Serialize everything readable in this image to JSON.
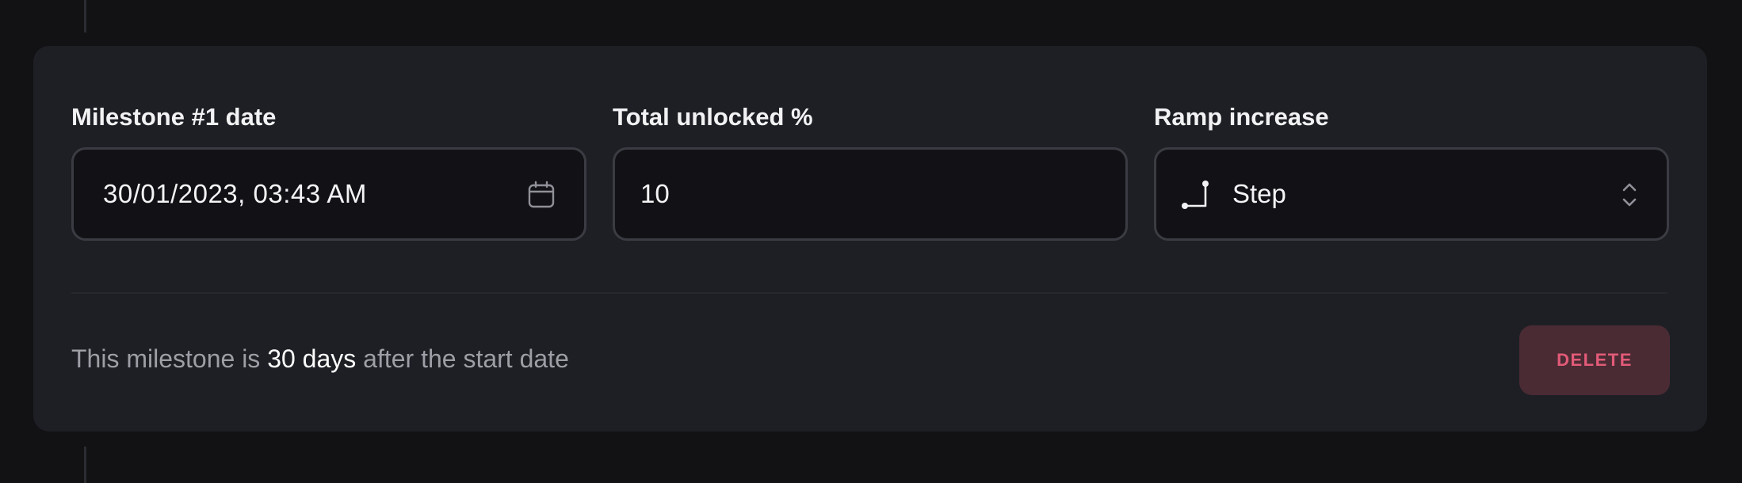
{
  "milestone": {
    "date_field": {
      "label": "Milestone #1 date",
      "value": "30/01/2023, 03:43 AM",
      "icon": "calendar-icon"
    },
    "unlocked_field": {
      "label": "Total unlocked %",
      "value": "10"
    },
    "ramp_field": {
      "label": "Ramp increase",
      "value": "Step",
      "icon": "step-icon",
      "indicator_icon": "chevron-up-down-icon"
    },
    "info": {
      "prefix": "This milestone is ",
      "highlight": "30 days",
      "suffix": " after the start date"
    },
    "delete_label": "DELETE"
  },
  "colors": {
    "background": "#121215",
    "card": "#1e1f24",
    "input_bg": "#121216",
    "input_border": "#3b3c43",
    "text_primary": "#f2f2f4",
    "text_muted": "#9d9ea6",
    "danger_text": "#e25b78",
    "danger_bg": "#4a2b34"
  }
}
